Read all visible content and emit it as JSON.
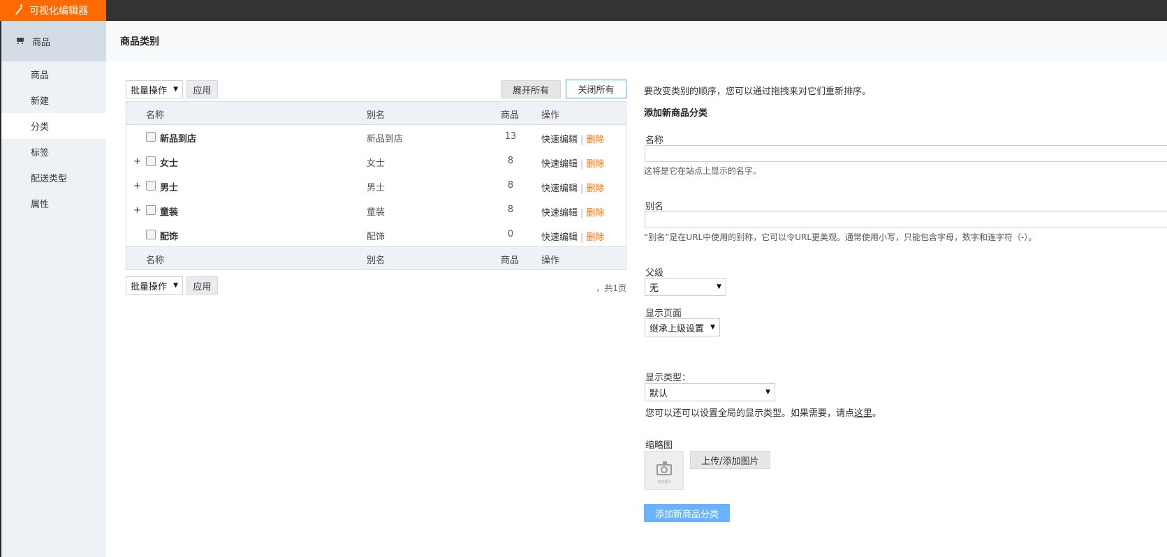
{
  "app": {
    "brand": "可视化编辑器"
  },
  "sidebar": {
    "header": "商品",
    "items": [
      {
        "label": "商品"
      },
      {
        "label": "新建"
      },
      {
        "label": "分类"
      },
      {
        "label": "标签"
      },
      {
        "label": "配送类型"
      },
      {
        "label": "属性"
      }
    ]
  },
  "page": {
    "title": "商品类别"
  },
  "toolbar": {
    "bulk_select": "批量操作",
    "apply_label": "应用",
    "expand_all": "展开所有",
    "collapse_all": "关闭所有"
  },
  "table": {
    "columns": {
      "name": "名称",
      "slug": "别名",
      "count": "商品",
      "ops": "操作"
    },
    "rows": [
      {
        "name": "新品到店",
        "slug": "新品到店",
        "count": "13",
        "expandable": false
      },
      {
        "name": "女士",
        "slug": "女士",
        "count": "8",
        "expandable": true
      },
      {
        "name": "男士",
        "slug": "男士",
        "count": "8",
        "expandable": true
      },
      {
        "name": "童装",
        "slug": "童装",
        "count": "8",
        "expandable": true
      },
      {
        "name": "配饰",
        "slug": "配饰",
        "count": "0",
        "expandable": false
      }
    ],
    "quick_edit": "快速编辑",
    "delete": "删除",
    "expand_glyph": "+",
    "pagination": "，共1页"
  },
  "form": {
    "intro": "要改变类别的顺序，您可以通过拖拽来对它们重新排序。",
    "title": "添加新商品分类",
    "name_label": "名称",
    "name_hint": "这将是它在站点上显示的名字。",
    "slug_label": "别名",
    "slug_hint": "“别名”是在URL中使用的别称，它可以令URL更美观。通常使用小写，只能包含字母，数字和连字符（-）。",
    "parent_label": "父级",
    "parent_value": "无",
    "display_page_label": "显示页面",
    "display_page_value": "继承上级设置",
    "display_type_label": "显示类型：",
    "display_type_value": "默认",
    "display_type_hint": "您可以还可以设置全局的显示类型。如果需要，请点",
    "display_type_link": "这里",
    "display_type_end": "。",
    "thumbnail_label": "缩略图",
    "thumbnail_placeholder": "暂无图片",
    "upload_label": "上传/添加图片",
    "submit_label": "添加新商品分类"
  }
}
